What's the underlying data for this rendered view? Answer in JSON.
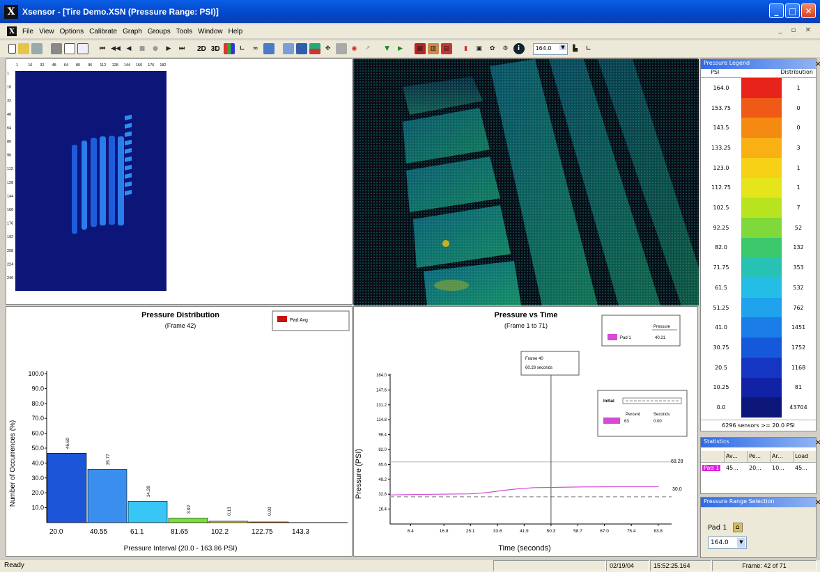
{
  "window": {
    "title": "Xsensor - [Tire Demo.XSN (Pressure Range: PSI)]",
    "logo": "X"
  },
  "menu": [
    "File",
    "View",
    "Options",
    "Calibrate",
    "Graph",
    "Groups",
    "Tools",
    "Window",
    "Help"
  ],
  "toolbar": {
    "btn_2d": "2D",
    "btn_3d": "3D",
    "zoom_value": "164.0",
    "icons": [
      "new-file-icon",
      "open-folder-icon",
      "save-icon",
      "print-icon",
      "print-preview-icon",
      "copy-icon",
      "first-frame-icon",
      "prev-frame-icon",
      "step-back-icon",
      "stop-icon",
      "record-icon",
      "play-icon",
      "last-frame-icon",
      "bar-chart-icon",
      "graph-icon",
      "binoculars-icon",
      "grid-icon",
      "tag-icon",
      "stats-icon",
      "pin-icon",
      "camera-icon",
      "target-icon",
      "cursor-icon",
      "arrow-down-icon",
      "arrow-right-icon",
      "color-grid-icon",
      "cube-icon",
      "display-icon",
      "phone-icon",
      "doc-icon",
      "cart-icon",
      "person-icon",
      "info-icon",
      "bar-icon",
      "line-icon"
    ]
  },
  "sensor_map": {
    "col_ticks": [
      "1",
      "16",
      "32",
      "48",
      "64",
      "80",
      "96",
      "112",
      "128",
      "144",
      "160",
      "176",
      "182"
    ],
    "row_ticks": [
      "1",
      "16",
      "32",
      "48",
      "64",
      "80",
      "96",
      "112",
      "128",
      "144",
      "160",
      "176",
      "192",
      "208",
      "224",
      "240"
    ]
  },
  "histogram": {
    "title": "Pressure Distribution",
    "subtitle": "(Frame 42)",
    "legend_label": "Pad Avg",
    "chart_data": {
      "type": "bar",
      "categories": [
        "20.0",
        "40.55",
        "61.1",
        "81.65",
        "102.2",
        "122.75",
        "143.3"
      ],
      "values": [
        46.6,
        35.77,
        14.28,
        3.02,
        0.13,
        0.0
      ],
      "value_labels": [
        "46.60",
        "35.77",
        "14.28",
        "3.02",
        "0.13",
        "0.00"
      ],
      "colors": [
        "#1d55d8",
        "#3a8fee",
        "#37c6f5",
        "#78e03a",
        "#e8d02a",
        "#f09020"
      ],
      "yticks": [
        "100.0",
        "90.0",
        "80.0",
        "70.0",
        "60.0",
        "50.0",
        "40.0",
        "30.0",
        "20.0",
        "10.0"
      ],
      "ylim": [
        0,
        100
      ],
      "xlabel": "Pressure Interval (20.0 - 163.86 PSI)",
      "ylabel": "Number of Occurrences (%)"
    }
  },
  "timeplot": {
    "title": "Pressure vs Time",
    "subtitle": "(Frame 1 to 71)",
    "legend_series": "Pad 1",
    "legend_header": "Pressure",
    "legend_value": "40.21",
    "cursor_label_1": "Frame 40",
    "cursor_label_2": "60.28 seconds",
    "box_title": "Initial",
    "box_col1": "Percent",
    "box_col2": "Seconds",
    "box_val1": "63",
    "box_val2": "0.00",
    "upper_label": "68.28",
    "lower_label": "30.0",
    "chart_data": {
      "type": "line",
      "xticks": [
        "6.4",
        "16.8",
        "25.1",
        "33.6",
        "41.9",
        "50.3",
        "58.7",
        "67.0",
        "75.4",
        "83.8"
      ],
      "yticks": [
        "164.0",
        "147.6",
        "131.2",
        "114.8",
        "98.4",
        "82.0",
        "65.6",
        "49.2",
        "32.8",
        "16.4"
      ],
      "ylim": [
        0,
        164
      ],
      "xlim": [
        0,
        88
      ],
      "threshold_upper": 68.28,
      "threshold_lower": 30.0,
      "cursor_x": 50.3,
      "series": [
        {
          "name": "Pad 1",
          "color": "#d64ad6",
          "x": [
            0,
            8,
            15,
            20,
            25,
            30,
            35,
            40,
            45,
            50,
            55,
            60,
            65,
            70,
            75,
            80,
            84
          ],
          "y": [
            32.0,
            32.5,
            32.8,
            33.0,
            33.2,
            34.5,
            36.8,
            38.8,
            40.0,
            40.2,
            40.5,
            40.8,
            40.9,
            41.0,
            41.0,
            41.0,
            41.0
          ]
        }
      ],
      "xlabel": "Time (seconds)",
      "ylabel": "Pressure (PSI)"
    }
  },
  "legend": {
    "title": "Pressure Legend",
    "col_psi": "PSI",
    "col_dist": "Distribution",
    "rows": [
      {
        "psi": "164.0",
        "count": "1",
        "color": "#e8231b"
      },
      {
        "psi": "153.75",
        "count": "0",
        "color": "#ef5a16"
      },
      {
        "psi": "143.5",
        "count": "0",
        "color": "#f58a12"
      },
      {
        "psi": "133.25",
        "count": "3",
        "color": "#f9b014"
      },
      {
        "psi": "123.0",
        "count": "1",
        "color": "#f7d116"
      },
      {
        "psi": "112.75",
        "count": "1",
        "color": "#e6e41a"
      },
      {
        "psi": "102.5",
        "count": "7",
        "color": "#b8e31f"
      },
      {
        "psi": "92.25",
        "count": "52",
        "color": "#7fd93a"
      },
      {
        "psi": "82.0",
        "count": "132",
        "color": "#3cc96b"
      },
      {
        "psi": "71.75",
        "count": "353",
        "color": "#27c2b4"
      },
      {
        "psi": "61.5",
        "count": "532",
        "color": "#24bde6"
      },
      {
        "psi": "51.25",
        "count": "762",
        "color": "#1ea3ec"
      },
      {
        "psi": "41.0",
        "count": "1451",
        "color": "#1a7de8"
      },
      {
        "psi": "30.75",
        "count": "1752",
        "color": "#1658da"
      },
      {
        "psi": "20.5",
        "count": "1168",
        "color": "#1536c2"
      },
      {
        "psi": "10.25",
        "count": "81",
        "color": "#1222a6"
      },
      {
        "psi": "0.0",
        "count": "43704",
        "color": "#0c1678"
      }
    ],
    "footer": "6296 sensors >= 20.0 PSI"
  },
  "stats": {
    "title": "Statistics",
    "headers": [
      "Av...",
      "Pe...",
      "Ar...",
      "Load"
    ],
    "row_label": "Pad 1",
    "row_values": [
      "45...",
      "20...",
      "10...",
      "45..."
    ]
  },
  "range_panel": {
    "title": "Pressure Range Selection",
    "pad_label": "Pad 1",
    "value": "164.0"
  },
  "status": {
    "ready": "Ready",
    "date": "02/19/04",
    "time": "15:52:25.164",
    "frame": "Frame: 42 of 71"
  }
}
